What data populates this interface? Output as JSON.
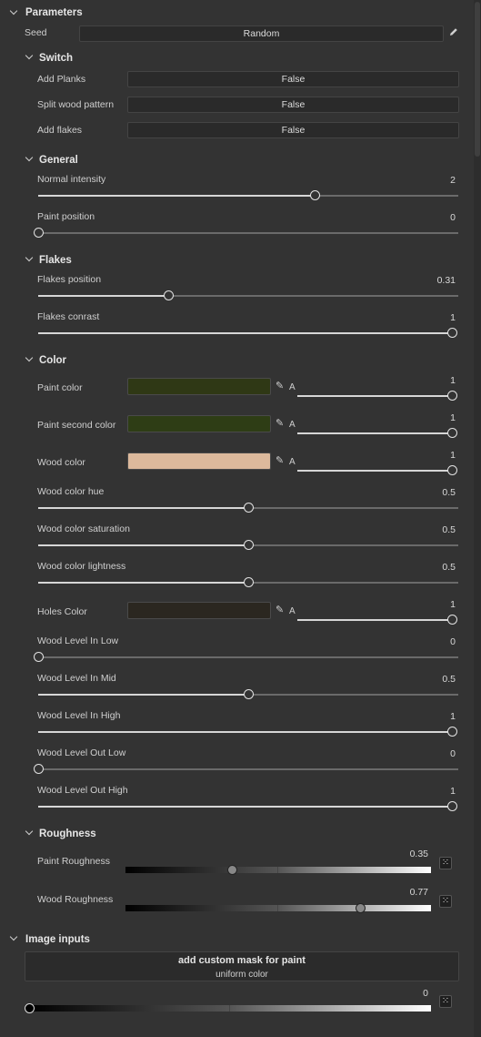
{
  "parameters": {
    "title": "Parameters",
    "seed_label": "Seed",
    "seed_value": "Random"
  },
  "switch": {
    "title": "Switch",
    "rows": [
      {
        "label": "Add Planks",
        "value": "False"
      },
      {
        "label": "Split wood pattern",
        "value": "False"
      },
      {
        "label": "Add flakes",
        "value": "False"
      }
    ]
  },
  "general": {
    "title": "General",
    "normal_intensity": {
      "label": "Normal intensity",
      "value": "2",
      "fraction": 0.66
    },
    "paint_position": {
      "label": "Paint position",
      "value": "0",
      "fraction": 0.0
    }
  },
  "flakes": {
    "title": "Flakes",
    "position": {
      "label": "Flakes position",
      "value": "0.31",
      "fraction": 0.31
    },
    "contrast": {
      "label": "Flakes conrast",
      "value": "1",
      "fraction": 1.0
    }
  },
  "color": {
    "title": "Color",
    "alpha_label": "A",
    "paint_color": {
      "label": "Paint color",
      "color": "#2f3815",
      "alpha": "1",
      "fraction": 1.0
    },
    "paint_second_color": {
      "label": "Paint second color",
      "color": "#2e3d15",
      "alpha": "1",
      "fraction": 1.0
    },
    "wood_color": {
      "label": "Wood color",
      "color": "#dcb99c",
      "alpha": "1",
      "fraction": 1.0
    },
    "wood_color_hue": {
      "label": "Wood color hue",
      "value": "0.5",
      "fraction": 0.5
    },
    "wood_color_saturation": {
      "label": "Wood color saturation",
      "value": "0.5",
      "fraction": 0.5
    },
    "wood_color_lightness": {
      "label": "Wood color lightness",
      "value": "0.5",
      "fraction": 0.5
    },
    "holes_color": {
      "label": "Holes Color",
      "color": "#2b2720",
      "alpha": "1",
      "fraction": 1.0
    },
    "wood_level_in_low": {
      "label": "Wood Level In Low",
      "value": "0",
      "fraction": 0.0
    },
    "wood_level_in_mid": {
      "label": "Wood Level In Mid",
      "value": "0.5",
      "fraction": 0.5
    },
    "wood_level_in_high": {
      "label": "Wood Level In High",
      "value": "1",
      "fraction": 1.0
    },
    "wood_level_out_low": {
      "label": "Wood Level Out Low",
      "value": "0",
      "fraction": 0.0
    },
    "wood_level_out_high": {
      "label": "Wood Level Out High",
      "value": "1",
      "fraction": 1.0
    }
  },
  "roughness": {
    "title": "Roughness",
    "paint": {
      "label": "Paint Roughness",
      "value": "0.35",
      "fraction": 0.35
    },
    "wood": {
      "label": "Wood Roughness",
      "value": "0.77",
      "fraction": 0.77
    }
  },
  "image_inputs": {
    "title": "Image inputs",
    "mask_title": "add custom mask for paint",
    "mask_sub": "uniform color",
    "value": "0",
    "fraction": 0.0
  },
  "icons": {
    "collapse": "chevron-down-icon",
    "edit": "pencil-icon",
    "picker": "eyedropper-icon",
    "random": "dice-icon"
  }
}
